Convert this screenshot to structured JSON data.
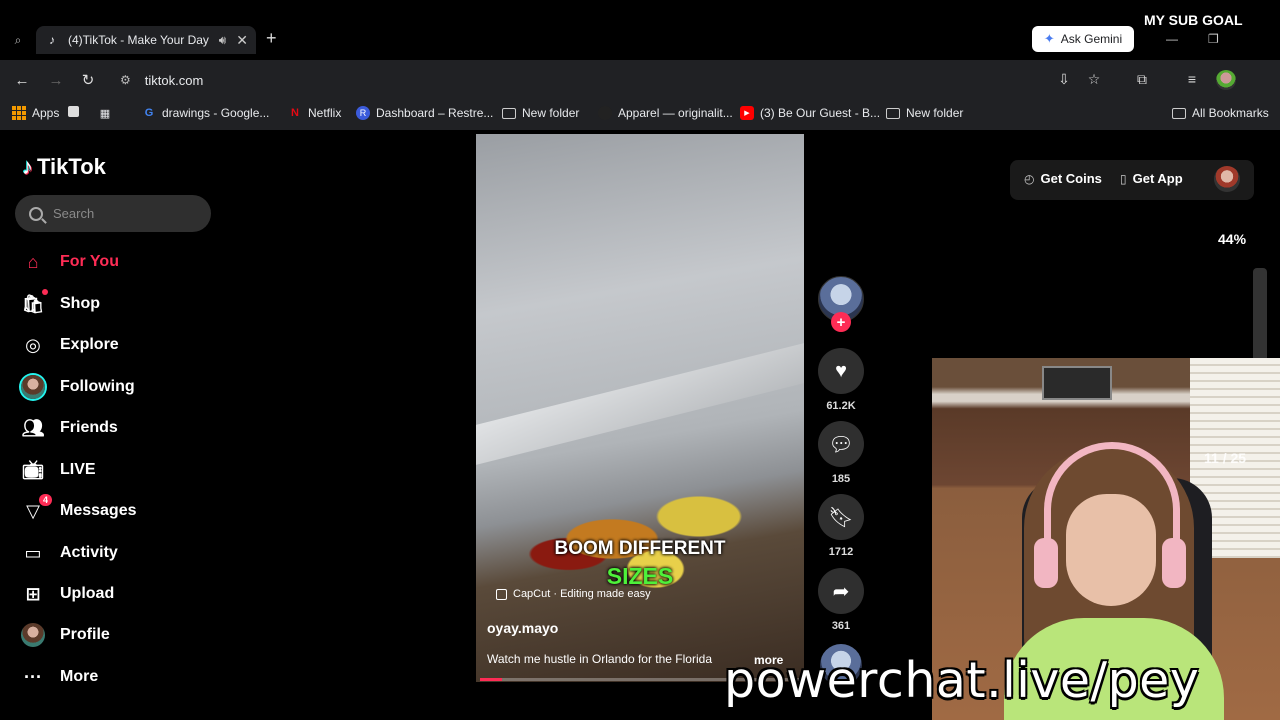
{
  "overlay": {
    "sub_goal": "MY SUB GOAL",
    "goal_percent_text": "44%",
    "goal_progress": 0.44,
    "pager": "11 / 25",
    "promo_text": "powerchat.live/pey"
  },
  "browser": {
    "tab_title": "(4)TikTok - Make Your Day",
    "new_tab": "+",
    "gemini_label": "Ask Gemini",
    "url": "tiktok.com",
    "bookmarks": [
      "Apps",
      "drawings - Google...",
      "Netflix",
      "Dashboard – Restre...",
      "New folder",
      "Apparel — originalit...",
      "(3) Be Our Guest - B...",
      "New folder",
      "All Bookmarks"
    ]
  },
  "tiktok": {
    "logo": "TikTok",
    "search_placeholder": "Search",
    "nav": [
      {
        "label": "For You",
        "icon": "home-icon"
      },
      {
        "label": "Shop",
        "icon": "shopping-bag-icon"
      },
      {
        "label": "Explore",
        "icon": "compass-icon"
      },
      {
        "label": "Following",
        "icon": "avatar-icon"
      },
      {
        "label": "Friends",
        "icon": "people-icon"
      },
      {
        "label": "LIVE",
        "icon": "tv-icon"
      },
      {
        "label": "Messages",
        "icon": "send-icon",
        "badge": "4"
      },
      {
        "label": "Activity",
        "icon": "message-box-icon"
      },
      {
        "label": "Upload",
        "icon": "plus-square-icon"
      },
      {
        "label": "Profile",
        "icon": "avatar-icon"
      },
      {
        "label": "More",
        "icon": "more-dots-icon"
      }
    ],
    "get_coins": "Get Coins",
    "get_app": "Get App",
    "video": {
      "caption_line1": "BOOM DIFFERENT",
      "caption_line2": "SIZES",
      "capcut": "CapCut · Editing made easy",
      "author": "oyay.mayo",
      "description": "Watch me hustle in Orlando for the Florida",
      "more": "more",
      "progress": 0.07
    },
    "actions": {
      "likes": "61.2K",
      "comments": "185",
      "saves": "1712",
      "shares": "361"
    }
  },
  "colors": {
    "accent": "#fe2c55",
    "goal_fill": "#ff3ca8",
    "caption_green": "#4ef03a"
  }
}
